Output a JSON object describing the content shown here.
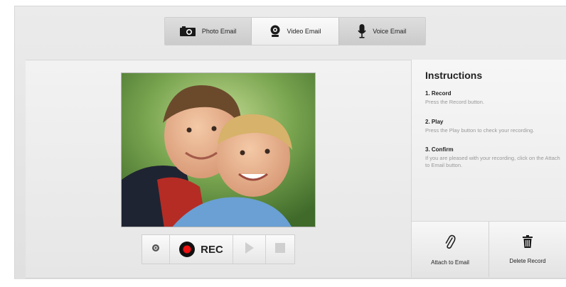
{
  "tabs": [
    {
      "label": "Photo Email",
      "icon": "camera-icon",
      "active": false
    },
    {
      "label": "Video Email",
      "icon": "webcam-icon",
      "active": true
    },
    {
      "label": "Voice Email",
      "icon": "microphone-icon",
      "active": false
    }
  ],
  "recorder": {
    "preview_icon": "video-preview",
    "settings_icon": "gear-icon",
    "rec_label": "REC",
    "play_icon": "play-icon",
    "stop_icon": "stop-icon",
    "rec_color": "#e11111"
  },
  "instructions": {
    "title": "Instructions",
    "steps": [
      {
        "title": "1. Record",
        "text": "Press the Record button."
      },
      {
        "title": "2. Play",
        "text": "Press the Play button to check your recording."
      },
      {
        "title": "3. Confirm",
        "text": "If you are pleased with your recording, click on the Attach to Email button."
      }
    ]
  },
  "actions": {
    "attach_label": "Attach to Email",
    "attach_icon": "paperclip-icon",
    "delete_label": "Delete Record",
    "delete_icon": "trash-icon"
  }
}
